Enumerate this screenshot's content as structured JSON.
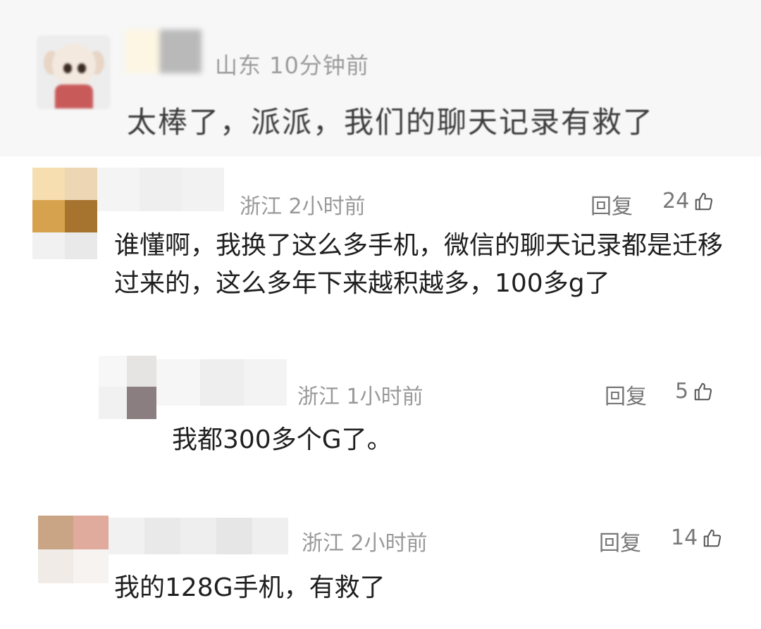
{
  "comments": [
    {
      "location": "山东",
      "time": "10分钟前",
      "text": "太棒了，派派，我们的聊天记录有救了"
    },
    {
      "location": "浙江",
      "time": "2小时前",
      "reply_label": "回复",
      "likes": "24",
      "text": "谁懂啊，我换了这么多手机，微信的聊天记录都是迁移过来的，这么多年下来越积越多，100多g了"
    },
    {
      "location": "浙江",
      "time": "1小时前",
      "reply_label": "回复",
      "likes": "5",
      "text": "我都300多个G了。"
    },
    {
      "location": "浙江",
      "time": "2小时前",
      "reply_label": "回复",
      "likes": "14",
      "text": "我的128G手机，有救了"
    }
  ],
  "icons": {
    "like": "thumbs-up-icon",
    "avatar": "avatar-mosaic"
  },
  "colors": {
    "meta_gray": "#999999",
    "text": "#1f1f1f"
  }
}
